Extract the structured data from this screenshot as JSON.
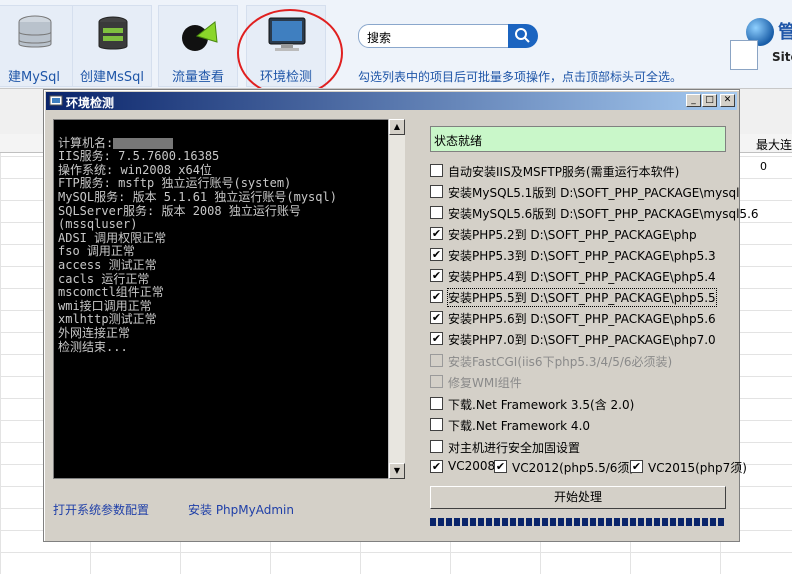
{
  "toolbar": {
    "buttons": [
      {
        "label": "建MySql",
        "icon": "database-icon"
      },
      {
        "label": "创建MsSql",
        "icon": "database-icon"
      },
      {
        "label": "流量查看",
        "icon": "chart-icon"
      },
      {
        "label": "环境检测",
        "icon": "monitor-icon"
      }
    ],
    "search_label": "搜索",
    "hint": "勾选列表中的项目后可批量多项操作，点击顶部标头可全选。",
    "brand_char": "管",
    "brand_sub": "Site"
  },
  "grid": {
    "col_max": "最大连",
    "cell_value": "0"
  },
  "dialog": {
    "title": "环境检测",
    "console_lines": [
      "计算机名:",
      "IIS服务: 7.5.7600.16385",
      "操作系统: win2008 x64位",
      "FTP服务: msftp 独立运行账号(system)",
      "MySQL服务: 版本 5.1.61 独立运行账号(mysql)",
      "SQLServer服务: 版本 2008 独立运行账号",
      "(mssqluser)",
      "ADSI 调用权限正常",
      "fso 调用正常",
      "access 测试正常",
      "cacls 运行正常",
      "mscomctl组件正常",
      "wmi接口调用正常",
      "xmlhttp测试正常",
      "外网连接正常",
      "检测结束..."
    ],
    "link_params": "打开系统参数配置",
    "link_phpmyadmin": "安装 PhpMyAdmin",
    "status": "状态就绪",
    "options": [
      {
        "label": "自动安装IIS及MSFTP服务(需重运行本软件)",
        "checked": false,
        "disabled": false
      },
      {
        "label": "安装MySQL5.1版到 D:\\SOFT_PHP_PACKAGE\\mysql",
        "checked": false,
        "disabled": false
      },
      {
        "label": "安装MySQL5.6版到 D:\\SOFT_PHP_PACKAGE\\mysql5.6",
        "checked": false,
        "disabled": false
      },
      {
        "label": "安装PHP5.2到 D:\\SOFT_PHP_PACKAGE\\php",
        "checked": true,
        "disabled": false
      },
      {
        "label": "安装PHP5.3到 D:\\SOFT_PHP_PACKAGE\\php5.3",
        "checked": true,
        "disabled": false
      },
      {
        "label": "安装PHP5.4到 D:\\SOFT_PHP_PACKAGE\\php5.4",
        "checked": true,
        "disabled": false
      },
      {
        "label": "安装PHP5.5到 D:\\SOFT_PHP_PACKAGE\\php5.5",
        "checked": true,
        "disabled": false
      },
      {
        "label": "安装PHP5.6到 D:\\SOFT_PHP_PACKAGE\\php5.6",
        "checked": true,
        "disabled": false
      },
      {
        "label": "安装PHP7.0到 D:\\SOFT_PHP_PACKAGE\\php7.0",
        "checked": true,
        "disabled": false
      },
      {
        "label": "安装FastCGI(iis6下php5.3/4/5/6必须装)",
        "checked": false,
        "disabled": true
      },
      {
        "label": "修复WMI组件",
        "checked": false,
        "disabled": true
      },
      {
        "label": "下载.Net Framework 3.5(含 2.0)",
        "checked": false,
        "disabled": false
      },
      {
        "label": "下载.Net Framework 4.0",
        "checked": false,
        "disabled": false
      },
      {
        "label": "对主机进行安全加固设置",
        "checked": false,
        "disabled": false
      }
    ],
    "vc_options": [
      {
        "label": "VC2008",
        "checked": true
      },
      {
        "label": "VC2012(php5.5/6须)",
        "checked": true
      },
      {
        "label": "VC2015(php7须)",
        "checked": true
      }
    ],
    "start_button": "开始处理"
  }
}
